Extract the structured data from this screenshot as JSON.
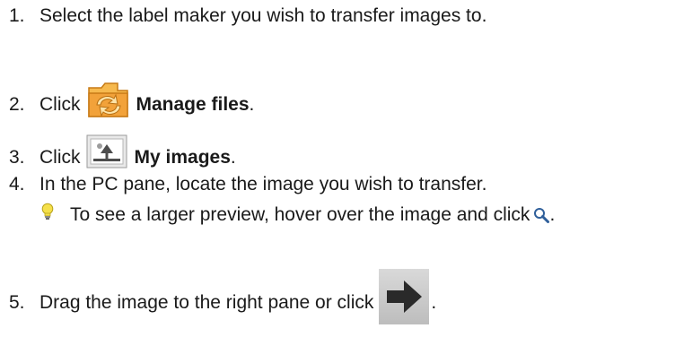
{
  "steps": [
    {
      "number": "1.",
      "text": "Select the label maker you wish to transfer images to."
    },
    {
      "number": "2.",
      "text_before": "Click",
      "bold": "Manage files",
      "text_after": ".",
      "icon": "manage-files-folder-icon"
    },
    {
      "number": "3.",
      "text_before": "Click",
      "bold": "My images",
      "text_after": ".",
      "icon": "my-images-icon"
    },
    {
      "number": "4.",
      "text": "In the PC pane, locate the image you wish to transfer."
    },
    {
      "number": "5.",
      "text_before": "Drag the image to the right pane or click",
      "text_after": ".",
      "icon": "transfer-arrow-icon"
    }
  ],
  "tip": {
    "icon": "lightbulb-icon",
    "text": "To see a larger preview, hover over the image and click",
    "text_after": ".",
    "trailing_icon": "magnifier-icon"
  },
  "colors": {
    "text": "#1a1a1a",
    "folder_orange": "#f2a23a",
    "bulb_yellow": "#f5e04a",
    "arrow_dark": "#2a2a2a",
    "magnifier_blue": "#2f5f9a"
  }
}
